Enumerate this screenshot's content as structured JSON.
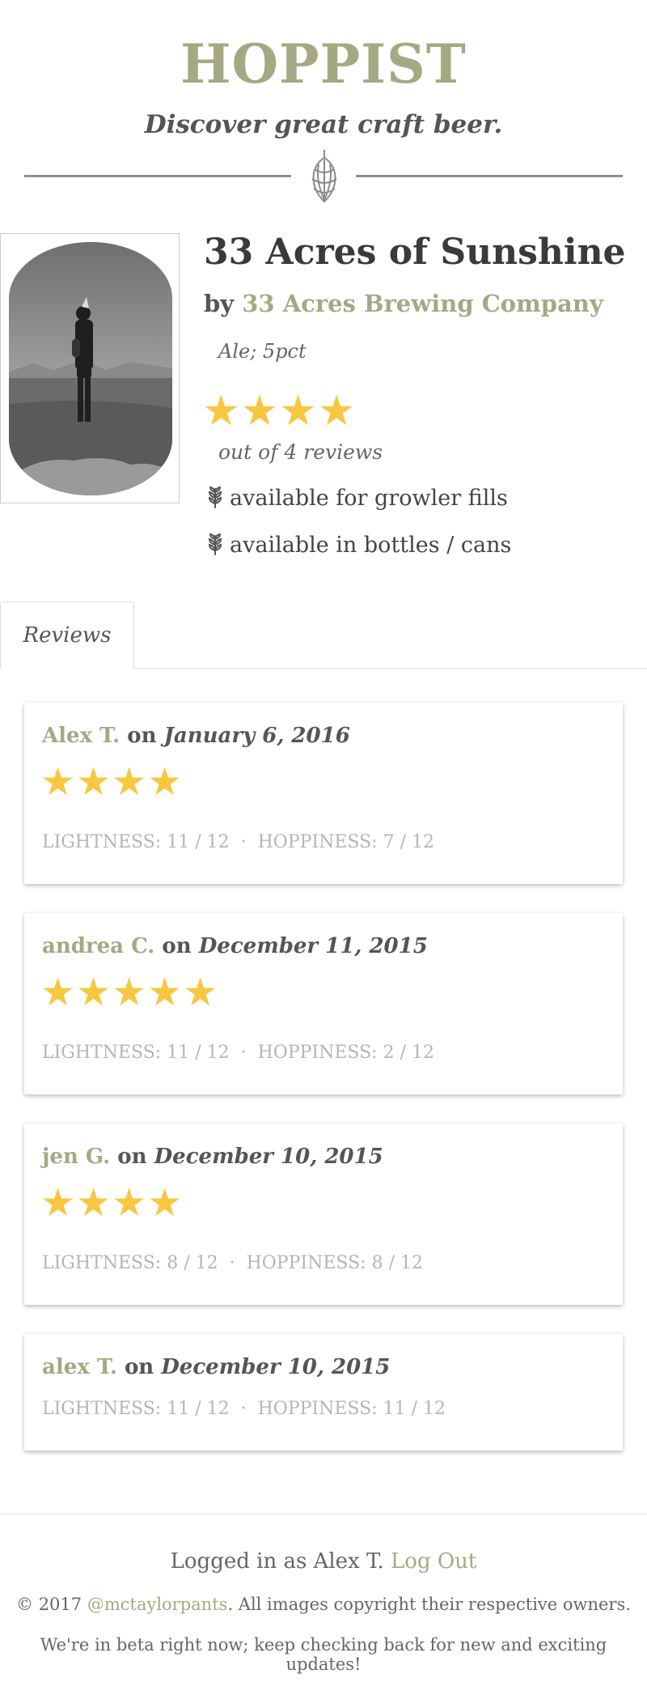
{
  "site": {
    "logo": "HOPPIST",
    "tagline": "Discover great craft beer."
  },
  "beer": {
    "name": "33 Acres of Sunshine",
    "by_prefix": "by",
    "brewery": "33 Acres Brewing Company",
    "style": "Ale; 5pct",
    "rating_stars": "★★★★",
    "review_count": "out of 4 reviews",
    "availability": [
      {
        "label": "available for growler fills"
      },
      {
        "label": "available in bottles / cans"
      }
    ]
  },
  "tabs": [
    {
      "label": "Reviews",
      "active": true
    }
  ],
  "reviews": [
    {
      "user": "Alex T.",
      "on": "on",
      "date": "January 6, 2016",
      "stars": "★★★★",
      "lightness": "LIGHTNESS: 11 / 12",
      "hoppiness": "HOPPINESS: 7 / 12"
    },
    {
      "user": "andrea C.",
      "on": "on",
      "date": "December 11, 2015",
      "stars": "★★★★★",
      "lightness": "LIGHTNESS: 11 / 12",
      "hoppiness": "HOPPINESS: 2 / 12"
    },
    {
      "user": "jen G.",
      "on": "on",
      "date": "December 10, 2015",
      "stars": "★★★★",
      "lightness": "LIGHTNESS: 8 / 12",
      "hoppiness": "HOPPINESS: 8 / 12"
    },
    {
      "user": "alex T.",
      "on": "on",
      "date": "December 10, 2015",
      "stars": "",
      "lightness": "LIGHTNESS: 11 / 12",
      "hoppiness": "HOPPINESS: 11 / 12"
    }
  ],
  "metric_separator": "·",
  "footer": {
    "logged_in_text": "Logged in as Alex T.",
    "logout_label": "Log Out",
    "copyright_prefix": "© 2017",
    "copyright_handle": "@mctaylorpants",
    "copyright_suffix": ". All images copyright their respective owners.",
    "beta_note": "We're in beta right now; keep checking back for new and exciting updates!"
  },
  "colors": {
    "accent": "#a6a883",
    "star": "#f8c740",
    "text": "#444444",
    "muted": "#b5b5b5"
  },
  "icons": [
    "hop-icon",
    "wheat-icon",
    "star-icon"
  ]
}
